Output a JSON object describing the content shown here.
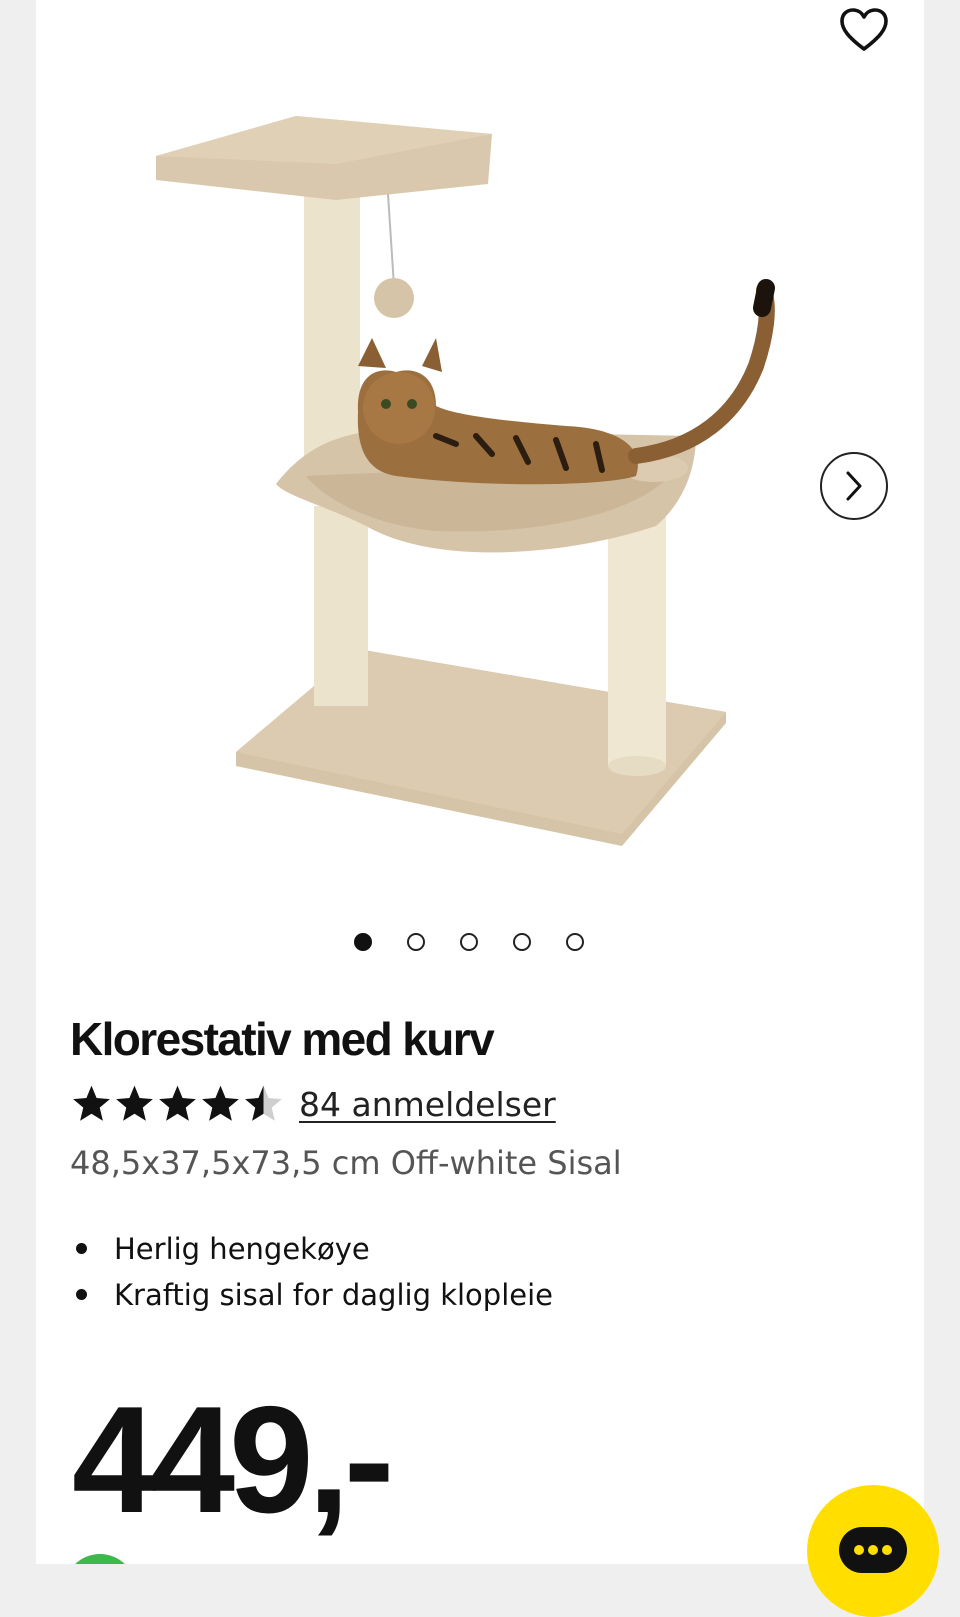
{
  "header": {
    "favorite_icon": "heart-outline-icon"
  },
  "gallery": {
    "total_images": 5,
    "active_index": 0,
    "next_icon": "chevron-right-icon",
    "image_subject": "cat-scratching-post-with-hammock"
  },
  "product": {
    "title": "Klorestativ med kurv",
    "rating": 4.5,
    "rating_max": 5,
    "reviews_label": "84 anmeldelser",
    "specs": "48,5x37,5x73,5 cm Off-white Sisal",
    "features": [
      "Herlig hengekøye",
      "Kraftig sisal for daglig klopleie"
    ],
    "price": "449,-"
  },
  "chat": {
    "icon": "chat-bubble-icon"
  },
  "colors": {
    "chat_button": "#ffde00",
    "badge": "#3cb94a",
    "carpet": "#d9c8ae",
    "sisal": "#eee5cf"
  }
}
